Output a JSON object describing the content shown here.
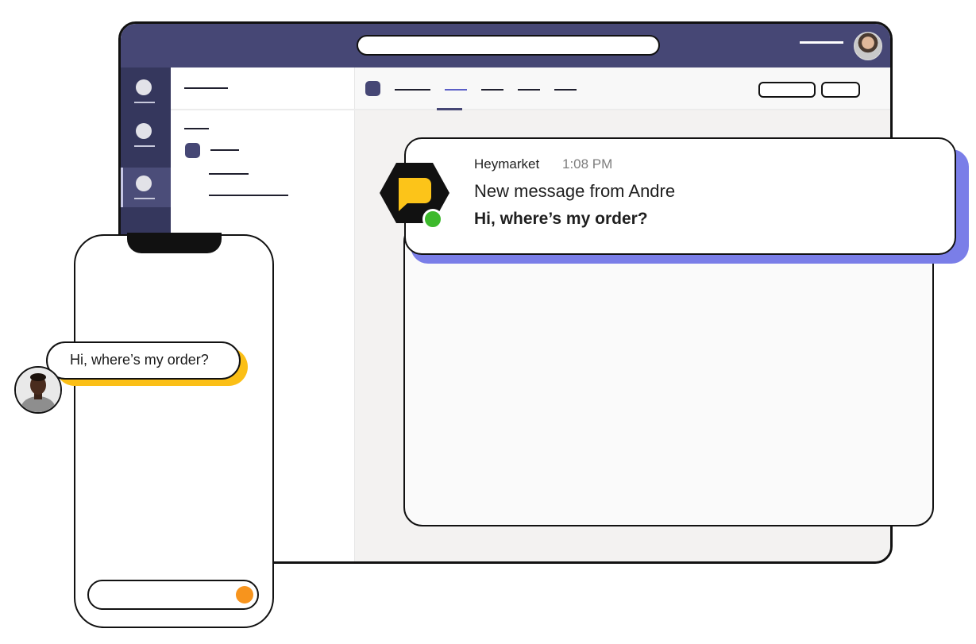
{
  "notification": {
    "app_name": "Heymarket",
    "time": "1:08 PM",
    "title": "New message from Andre",
    "body": "Hi, where’s my order?",
    "status": "online"
  },
  "phone": {
    "incoming_message": "Hi, where’s my order?",
    "send_button_color": "#f7941d"
  },
  "colors": {
    "app_header": "#464775",
    "rail": "#35375d",
    "notification_accent": "#7a7ee8",
    "bubble_accent": "#fbbf16",
    "online": "#3db92c",
    "logo_yellow": "#fcc419"
  },
  "icons": {
    "app_logo": "heymarket-logo-icon",
    "user_avatar": "avatar-icon",
    "contact_avatar": "andre-avatar"
  }
}
